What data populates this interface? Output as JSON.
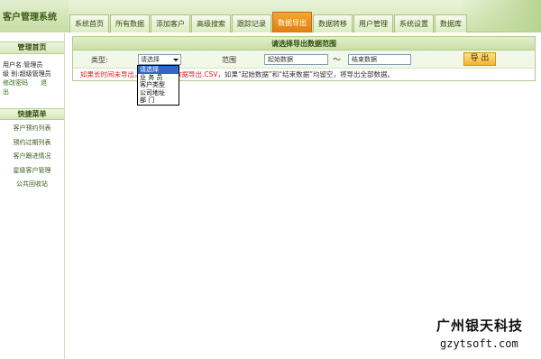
{
  "app": {
    "title": "客户管理系统"
  },
  "tabs": [
    {
      "label": "系统首页",
      "active": false
    },
    {
      "label": "所有数据",
      "active": false
    },
    {
      "label": "添加客户",
      "active": false
    },
    {
      "label": "高级搜索",
      "active": false
    },
    {
      "label": "跟踪记录",
      "active": false
    },
    {
      "label": "数据导出",
      "active": true
    },
    {
      "label": "数据转移",
      "active": false
    },
    {
      "label": "用户管理",
      "active": false
    },
    {
      "label": "系统设置",
      "active": false
    },
    {
      "label": "数据库",
      "active": false
    }
  ],
  "sidebar": {
    "admin_head": "管理首页",
    "user_line": "用户名:管理员",
    "level_line": "级 别:超级管理员",
    "change_password": "修改密码",
    "logout": "退出",
    "menu_head": "快捷菜单",
    "menu": [
      "客户预约列表",
      "预约过期列表",
      "客户跟进情况",
      "星级客户管理",
      "公共回收站"
    ]
  },
  "panel": {
    "title": "请选择导出数据范围",
    "type_label": "类型:",
    "type_selected": "请选择",
    "range_label": "范围",
    "start_value": "起始数据",
    "tilde": "～",
    "end_value": "结束数据",
    "export_button": "导 出",
    "note_red": "如果长时间未导出，请右键另存",
    "note_file": "数据导出.CSV",
    "note_rest": "，如果“起始数据”和“结束数据”均留空，将导出全部数据。"
  },
  "dropdown": {
    "options": [
      "请选择",
      "业 务 员",
      "客户类型",
      "公司地址",
      "部    门"
    ],
    "selected_index": 0
  },
  "watermark": {
    "line1": "广州银天科技",
    "line2": "gzytsoft.com"
  },
  "colors": {
    "active_tab": "#f39a24",
    "note_red": "#e21b1b",
    "select_highlight": "#316ac5"
  }
}
